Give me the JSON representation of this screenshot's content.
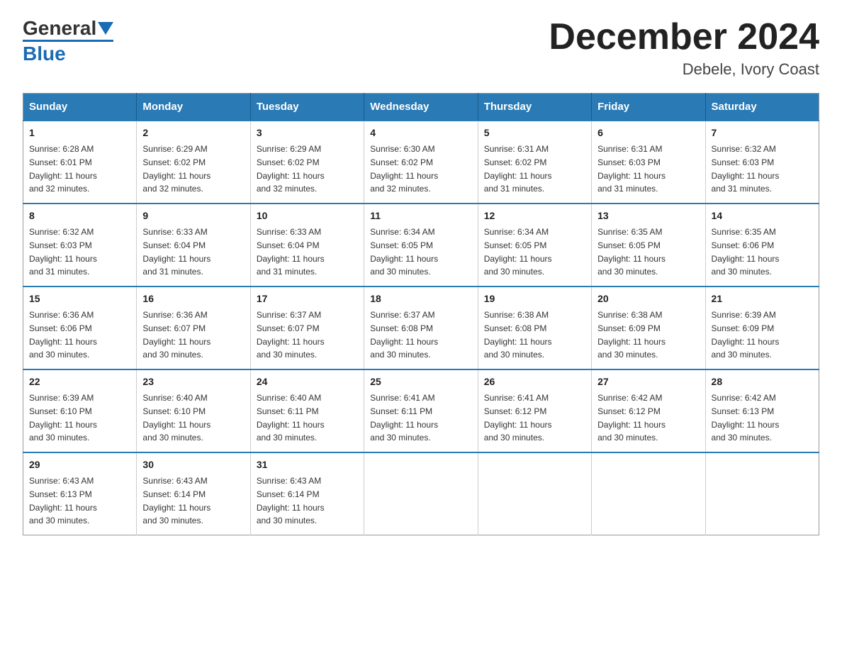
{
  "header": {
    "logo_general": "General",
    "logo_blue": "Blue",
    "title": "December 2024",
    "subtitle": "Debele, Ivory Coast"
  },
  "days_of_week": [
    "Sunday",
    "Monday",
    "Tuesday",
    "Wednesday",
    "Thursday",
    "Friday",
    "Saturday"
  ],
  "weeks": [
    [
      {
        "day": "1",
        "sunrise": "6:28 AM",
        "sunset": "6:01 PM",
        "daylight": "11 hours and 32 minutes."
      },
      {
        "day": "2",
        "sunrise": "6:29 AM",
        "sunset": "6:02 PM",
        "daylight": "11 hours and 32 minutes."
      },
      {
        "day": "3",
        "sunrise": "6:29 AM",
        "sunset": "6:02 PM",
        "daylight": "11 hours and 32 minutes."
      },
      {
        "day": "4",
        "sunrise": "6:30 AM",
        "sunset": "6:02 PM",
        "daylight": "11 hours and 32 minutes."
      },
      {
        "day": "5",
        "sunrise": "6:31 AM",
        "sunset": "6:02 PM",
        "daylight": "11 hours and 31 minutes."
      },
      {
        "day": "6",
        "sunrise": "6:31 AM",
        "sunset": "6:03 PM",
        "daylight": "11 hours and 31 minutes."
      },
      {
        "day": "7",
        "sunrise": "6:32 AM",
        "sunset": "6:03 PM",
        "daylight": "11 hours and 31 minutes."
      }
    ],
    [
      {
        "day": "8",
        "sunrise": "6:32 AM",
        "sunset": "6:03 PM",
        "daylight": "11 hours and 31 minutes."
      },
      {
        "day": "9",
        "sunrise": "6:33 AM",
        "sunset": "6:04 PM",
        "daylight": "11 hours and 31 minutes."
      },
      {
        "day": "10",
        "sunrise": "6:33 AM",
        "sunset": "6:04 PM",
        "daylight": "11 hours and 31 minutes."
      },
      {
        "day": "11",
        "sunrise": "6:34 AM",
        "sunset": "6:05 PM",
        "daylight": "11 hours and 30 minutes."
      },
      {
        "day": "12",
        "sunrise": "6:34 AM",
        "sunset": "6:05 PM",
        "daylight": "11 hours and 30 minutes."
      },
      {
        "day": "13",
        "sunrise": "6:35 AM",
        "sunset": "6:05 PM",
        "daylight": "11 hours and 30 minutes."
      },
      {
        "day": "14",
        "sunrise": "6:35 AM",
        "sunset": "6:06 PM",
        "daylight": "11 hours and 30 minutes."
      }
    ],
    [
      {
        "day": "15",
        "sunrise": "6:36 AM",
        "sunset": "6:06 PM",
        "daylight": "11 hours and 30 minutes."
      },
      {
        "day": "16",
        "sunrise": "6:36 AM",
        "sunset": "6:07 PM",
        "daylight": "11 hours and 30 minutes."
      },
      {
        "day": "17",
        "sunrise": "6:37 AM",
        "sunset": "6:07 PM",
        "daylight": "11 hours and 30 minutes."
      },
      {
        "day": "18",
        "sunrise": "6:37 AM",
        "sunset": "6:08 PM",
        "daylight": "11 hours and 30 minutes."
      },
      {
        "day": "19",
        "sunrise": "6:38 AM",
        "sunset": "6:08 PM",
        "daylight": "11 hours and 30 minutes."
      },
      {
        "day": "20",
        "sunrise": "6:38 AM",
        "sunset": "6:09 PM",
        "daylight": "11 hours and 30 minutes."
      },
      {
        "day": "21",
        "sunrise": "6:39 AM",
        "sunset": "6:09 PM",
        "daylight": "11 hours and 30 minutes."
      }
    ],
    [
      {
        "day": "22",
        "sunrise": "6:39 AM",
        "sunset": "6:10 PM",
        "daylight": "11 hours and 30 minutes."
      },
      {
        "day": "23",
        "sunrise": "6:40 AM",
        "sunset": "6:10 PM",
        "daylight": "11 hours and 30 minutes."
      },
      {
        "day": "24",
        "sunrise": "6:40 AM",
        "sunset": "6:11 PM",
        "daylight": "11 hours and 30 minutes."
      },
      {
        "day": "25",
        "sunrise": "6:41 AM",
        "sunset": "6:11 PM",
        "daylight": "11 hours and 30 minutes."
      },
      {
        "day": "26",
        "sunrise": "6:41 AM",
        "sunset": "6:12 PM",
        "daylight": "11 hours and 30 minutes."
      },
      {
        "day": "27",
        "sunrise": "6:42 AM",
        "sunset": "6:12 PM",
        "daylight": "11 hours and 30 minutes."
      },
      {
        "day": "28",
        "sunrise": "6:42 AM",
        "sunset": "6:13 PM",
        "daylight": "11 hours and 30 minutes."
      }
    ],
    [
      {
        "day": "29",
        "sunrise": "6:43 AM",
        "sunset": "6:13 PM",
        "daylight": "11 hours and 30 minutes."
      },
      {
        "day": "30",
        "sunrise": "6:43 AM",
        "sunset": "6:14 PM",
        "daylight": "11 hours and 30 minutes."
      },
      {
        "day": "31",
        "sunrise": "6:43 AM",
        "sunset": "6:14 PM",
        "daylight": "11 hours and 30 minutes."
      },
      null,
      null,
      null,
      null
    ]
  ],
  "labels": {
    "sunrise": "Sunrise:",
    "sunset": "Sunset:",
    "daylight": "Daylight:"
  }
}
